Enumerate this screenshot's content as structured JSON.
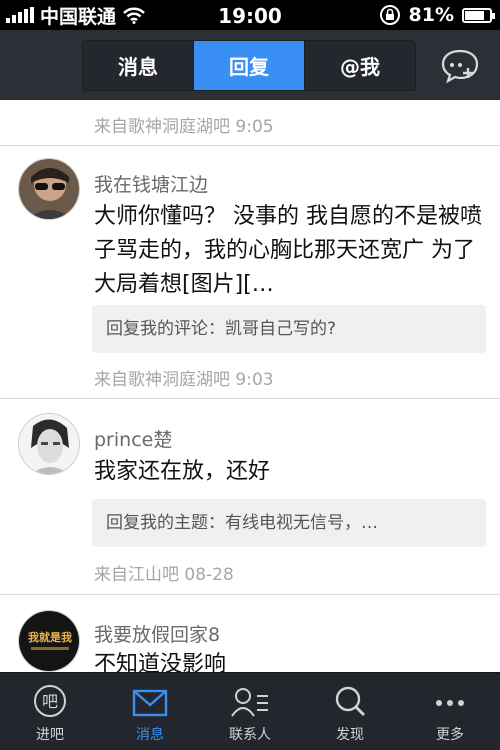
{
  "status_bar": {
    "carrier": "中国联通",
    "time": "19:00",
    "battery_pct": "81%",
    "battery_level": 0.81
  },
  "nav": {
    "segments": [
      "消息",
      "回复",
      "@我"
    ],
    "active_index": 1,
    "accent": "#3a8ff5"
  },
  "feed": {
    "top_meta": "来自歌神洞庭湖吧  9:05",
    "items": [
      {
        "username": "我在钱塘江边",
        "content": "大师你懂吗？ 没事的    我自愿的不是被喷子骂走的，我的心胸比那天还宽广    为了大局着想[图片][…",
        "quote": "回复我的评论：凯哥自己写的?",
        "meta": "来自歌神洞庭湖吧  9:03"
      },
      {
        "username": "prince楚",
        "content": "我家还在放，还好",
        "quote": "回复我的主题：有线电视无信号，…",
        "meta": "来自江山吧  08-28"
      },
      {
        "username": "我要放假回家8",
        "content": "不知道没影响",
        "avatar_text": "我就是我"
      }
    ]
  },
  "tab_bar": {
    "items": [
      {
        "label": "进吧",
        "icon": "ba-icon"
      },
      {
        "label": "消息",
        "icon": "mail-icon"
      },
      {
        "label": "联系人",
        "icon": "contacts-icon"
      },
      {
        "label": "发现",
        "icon": "search-icon"
      },
      {
        "label": "更多",
        "icon": "more-icon"
      }
    ],
    "active_index": 1
  }
}
